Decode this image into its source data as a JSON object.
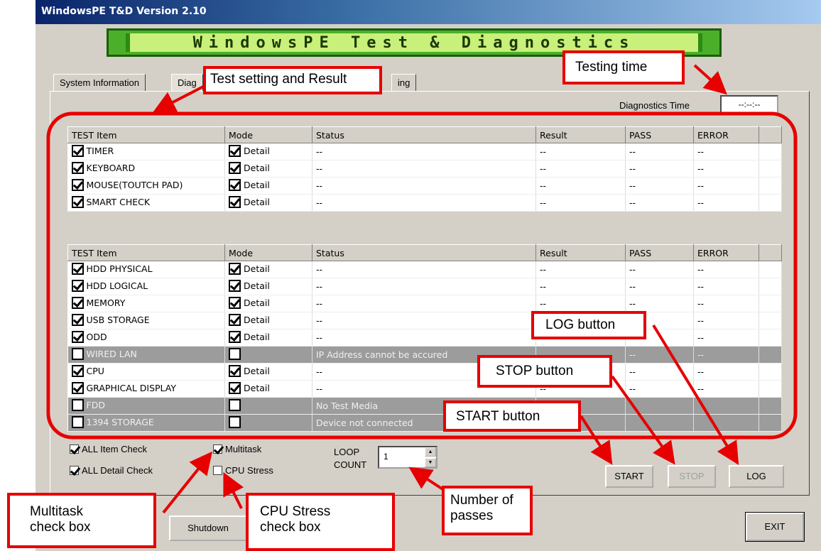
{
  "window": {
    "title": "WindowsPE T&D Version 2.10"
  },
  "banner": {
    "text": "WindowsPE Test & Diagnostics"
  },
  "tabs": [
    {
      "label": "System Information"
    },
    {
      "label": "Diag"
    },
    {
      "label": "ing"
    }
  ],
  "diagnostics_time": {
    "label": "Diagnostics Time",
    "value": "--:--:--"
  },
  "table_headers": [
    "TEST Item",
    "Mode",
    "Status",
    "Result",
    "PASS",
    "ERROR"
  ],
  "table1": [
    {
      "item": "TIMER",
      "checked": true,
      "mode": "Detail",
      "mode_checked": true,
      "status": "--",
      "result": "--",
      "pass": "--",
      "error": "--"
    },
    {
      "item": "KEYBOARD",
      "checked": true,
      "mode": "Detail",
      "mode_checked": true,
      "status": "--",
      "result": "--",
      "pass": "--",
      "error": "--"
    },
    {
      "item": "MOUSE(TOUTCH PAD)",
      "checked": true,
      "mode": "Detail",
      "mode_checked": true,
      "status": "--",
      "result": "--",
      "pass": "--",
      "error": "--"
    },
    {
      "item": "SMART CHECK",
      "checked": true,
      "mode": "Detail",
      "mode_checked": true,
      "status": "--",
      "result": "--",
      "pass": "--",
      "error": "--"
    }
  ],
  "table2": [
    {
      "item": "HDD PHYSICAL",
      "checked": true,
      "mode": "Detail",
      "mode_checked": true,
      "status": "--",
      "result": "--",
      "pass": "--",
      "error": "--",
      "disabled": false
    },
    {
      "item": "HDD LOGICAL",
      "checked": true,
      "mode": "Detail",
      "mode_checked": true,
      "status": "--",
      "result": "--",
      "pass": "--",
      "error": "--",
      "disabled": false
    },
    {
      "item": "MEMORY",
      "checked": true,
      "mode": "Detail",
      "mode_checked": true,
      "status": "--",
      "result": "--",
      "pass": "--",
      "error": "--",
      "disabled": false
    },
    {
      "item": "USB STORAGE",
      "checked": true,
      "mode": "Detail",
      "mode_checked": true,
      "status": "--",
      "result": "--",
      "pass": "--",
      "error": "--",
      "disabled": false
    },
    {
      "item": "ODD",
      "checked": true,
      "mode": "Detail",
      "mode_checked": true,
      "status": "--",
      "result": "--",
      "pass": "--",
      "error": "--",
      "disabled": false
    },
    {
      "item": "WIRED LAN",
      "checked": false,
      "mode": "",
      "mode_checked": false,
      "status": "IP Address cannot be accured",
      "result": "--",
      "pass": "--",
      "error": "--",
      "disabled": true
    },
    {
      "item": "CPU",
      "checked": true,
      "mode": "Detail",
      "mode_checked": true,
      "status": "--",
      "result": "--",
      "pass": "--",
      "error": "--",
      "disabled": false
    },
    {
      "item": "GRAPHICAL DISPLAY",
      "checked": true,
      "mode": "Detail",
      "mode_checked": true,
      "status": "--",
      "result": "--",
      "pass": "--",
      "error": "--",
      "disabled": false
    },
    {
      "item": "FDD",
      "checked": false,
      "mode": "",
      "mode_checked": false,
      "status": "No Test Media",
      "result": "",
      "pass": "",
      "error": "",
      "disabled": true
    },
    {
      "item": "1394 STORAGE",
      "checked": false,
      "mode": "",
      "mode_checked": false,
      "status": "Device not connected",
      "result": "",
      "pass": "",
      "error": "",
      "disabled": true
    }
  ],
  "options": {
    "all_item_check": "ALL Item Check",
    "all_detail_check": "ALL Detail Check",
    "multitask": "Multitask",
    "cpu_stress": "CPU Stress",
    "loop_count_label_1": "LOOP",
    "loop_count_label_2": "COUNT",
    "loop_count_value": "1"
  },
  "buttons": {
    "start": "START",
    "stop": "STOP",
    "log": "LOG",
    "shutdown": "Shutdown",
    "exit": "EXIT"
  },
  "callouts": {
    "test_setting": "Test setting and Result",
    "testing_time": "Testing time",
    "log_button": "LOG button",
    "stop_button": "STOP button",
    "start_button": "START button",
    "number_of_passes_1": "Number of",
    "number_of_passes_2": "passes",
    "multitask_1": "Multitask",
    "multitask_2": "check box",
    "cpu_stress_1": "CPU Stress",
    "cpu_stress_2": "check box"
  },
  "colors": {
    "annotation": "#e60000",
    "title_bar": "#0a246a",
    "banner": "#4caf2a",
    "disabled_row": "#9c9c9c"
  }
}
